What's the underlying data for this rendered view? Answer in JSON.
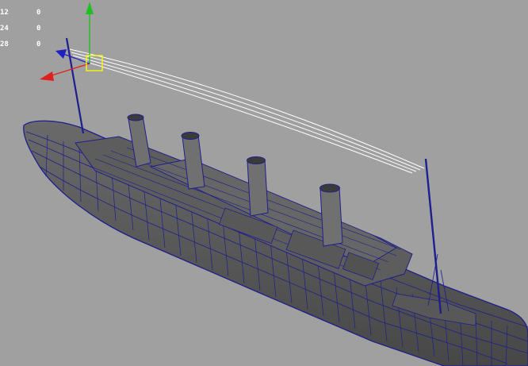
{
  "viewport": {
    "background_color": "#a0a0a0",
    "wireframe_color": "#1e1e8c",
    "hull_color": "#5a5a5a",
    "rope_color": "#ffffff"
  },
  "stats": [
    {
      "label": "12",
      "value": "0"
    },
    {
      "label": "24",
      "value": "0"
    },
    {
      "label": "28",
      "value": "0"
    }
  ],
  "manipulator": {
    "x_axis_color": "#e02020",
    "y_axis_color": "#20c020",
    "z_axis_color": "#2020c0",
    "selection_color": "#ffff00"
  },
  "model": {
    "funnels": 4,
    "masts": 2
  }
}
